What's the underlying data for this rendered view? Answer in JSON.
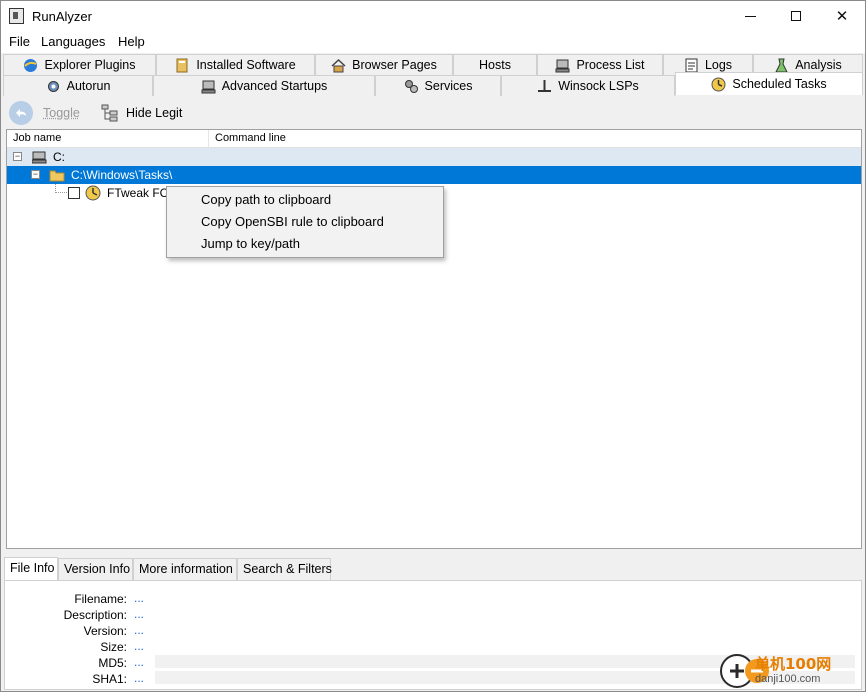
{
  "window": {
    "title": "RunAlyzer"
  },
  "menu": [
    "File",
    "Languages",
    "Help"
  ],
  "tabs_row1": [
    "Explorer Plugins",
    "Installed Software",
    "Browser Pages",
    "Hosts",
    "Process List",
    "Logs",
    "Analysis"
  ],
  "tabs_row2": [
    "Autorun",
    "Advanced Startups",
    "Services",
    "Winsock LSPs",
    "Scheduled Tasks"
  ],
  "active_tab": "Scheduled Tasks",
  "toolbar": {
    "toggle_label": "Toggle",
    "hide_legit_label": "Hide Legit"
  },
  "columns": {
    "job_name": "Job name",
    "command_line": "Command line"
  },
  "tree": {
    "root": "C:",
    "folder": "C:\\Windows\\Tasks\\",
    "task": "FTweak FCle"
  },
  "context_menu": [
    "Copy path to clipboard",
    "Copy OpenSBI rule to clipboard",
    "Jump to key/path"
  ],
  "bottom_tabs": [
    "File Info",
    "Version Info",
    "More information",
    "Search & Filters"
  ],
  "file_info": [
    {
      "label": "Filename:",
      "value": "..."
    },
    {
      "label": "Description:",
      "value": "..."
    },
    {
      "label": "Version:",
      "value": "..."
    },
    {
      "label": "Size:",
      "value": "..."
    },
    {
      "label": "MD5:",
      "value": "..."
    },
    {
      "label": "SHA1:",
      "value": "..."
    }
  ],
  "watermark": {
    "text_cn": "单机100网",
    "text_url": "danji100.com"
  },
  "colors": {
    "selection": "#0078d7",
    "root_row": "#dde8f3",
    "link": "#1a5fd0"
  }
}
